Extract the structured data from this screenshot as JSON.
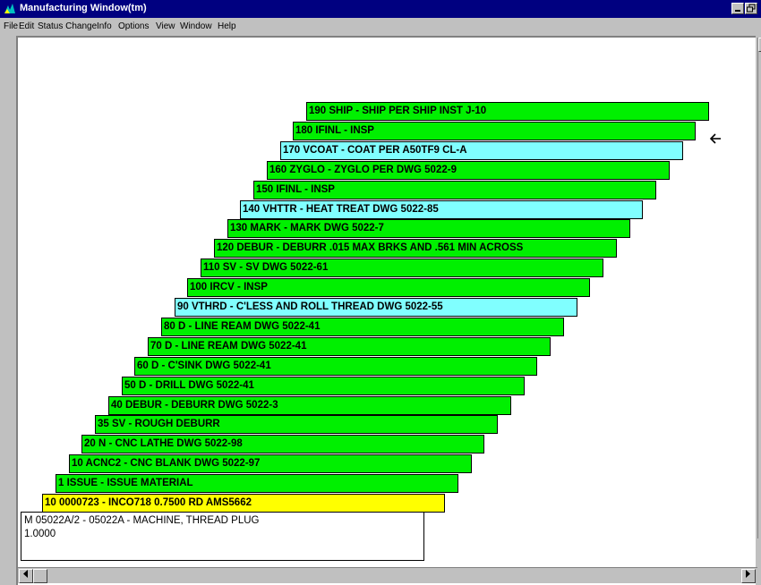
{
  "window": {
    "title": "Manufacturing Window(tm)"
  },
  "menu": [
    "File",
    "Edit",
    "Status Change",
    "Info",
    "Options",
    "View",
    "Window",
    "Help"
  ],
  "operations": [
    {
      "label": "190 SHIP - SHIP PER SHIP INST J-10",
      "color": "green"
    },
    {
      "label": "180 IFINL - INSP",
      "color": "green"
    },
    {
      "label": "170 VCOAT - COAT PER A50TF9 CL-A",
      "color": "cyan"
    },
    {
      "label": "160 ZYGLO - ZYGLO PER DWG 5022-9",
      "color": "green"
    },
    {
      "label": "150 IFINL - INSP",
      "color": "green"
    },
    {
      "label": "140 VHTTR - HEAT TREAT DWG 5022-85",
      "color": "cyan"
    },
    {
      "label": "130 MARK - MARK DWG 5022-7",
      "color": "green"
    },
    {
      "label": "120 DEBUR - DEBURR .015 MAX BRKS AND .561 MIN ACROSS",
      "color": "green"
    },
    {
      "label": "110 SV - SV DWG 5022-61",
      "color": "green"
    },
    {
      "label": "100 IRCV - INSP",
      "color": "green"
    },
    {
      "label": "90 VTHRD - C'LESS AND ROLL THREAD DWG 5022-55",
      "color": "cyan"
    },
    {
      "label": "80 D - LINE REAM DWG 5022-41",
      "color": "green"
    },
    {
      "label": "70 D - LINE REAM DWG 5022-41",
      "color": "green"
    },
    {
      "label": "60 D - C'SINK DWG 5022-41",
      "color": "green"
    },
    {
      "label": "50 D - DRILL DWG 5022-41",
      "color": "green"
    },
    {
      "label": "40 DEBUR - DEBURR DWG 5022-3",
      "color": "green"
    },
    {
      "label": "35 SV - ROUGH DEBURR",
      "color": "green"
    },
    {
      "label": "20 N - CNC LATHE DWG 5022-98",
      "color": "green"
    },
    {
      "label": "10 ACNC2 - CNC BLANK DWG 5022-97",
      "color": "green"
    },
    {
      "label": "1 ISSUE - ISSUE MATERIAL",
      "color": "green"
    },
    {
      "label": "10 0000723 - INCO718 0.7500 RD AMS5662",
      "color": "yellow"
    }
  ],
  "base_card": {
    "line1": "M 05022A/2 - 05022A - MACHINE, THREAD PLUG",
    "line2": "1.0000"
  },
  "colors": {
    "green": "#00f000",
    "cyan": "#80ffff",
    "yellow": "#ffff00",
    "titlebar": "#000080"
  }
}
